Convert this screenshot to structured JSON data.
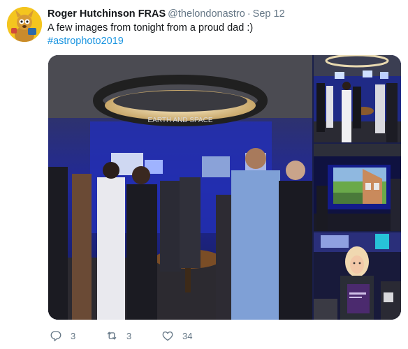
{
  "tweet": {
    "author_name": "Roger Hutchinson FRAS",
    "handle": "@thelondonastro",
    "separator": "·",
    "date": "Sep 12",
    "text": "A few images from tonight from a proud dad :)",
    "hashtag": "#astrophoto2019",
    "sign_text": "EARTH AND SPACE"
  },
  "actions": {
    "reply_count": "3",
    "retweet_count": "3",
    "like_count": "34"
  },
  "icons": {
    "reply": "reply-icon",
    "retweet": "retweet-icon",
    "like": "heart-icon"
  },
  "colors": {
    "link": "#1b95e0",
    "muted": "#657786",
    "text": "#14171a"
  }
}
